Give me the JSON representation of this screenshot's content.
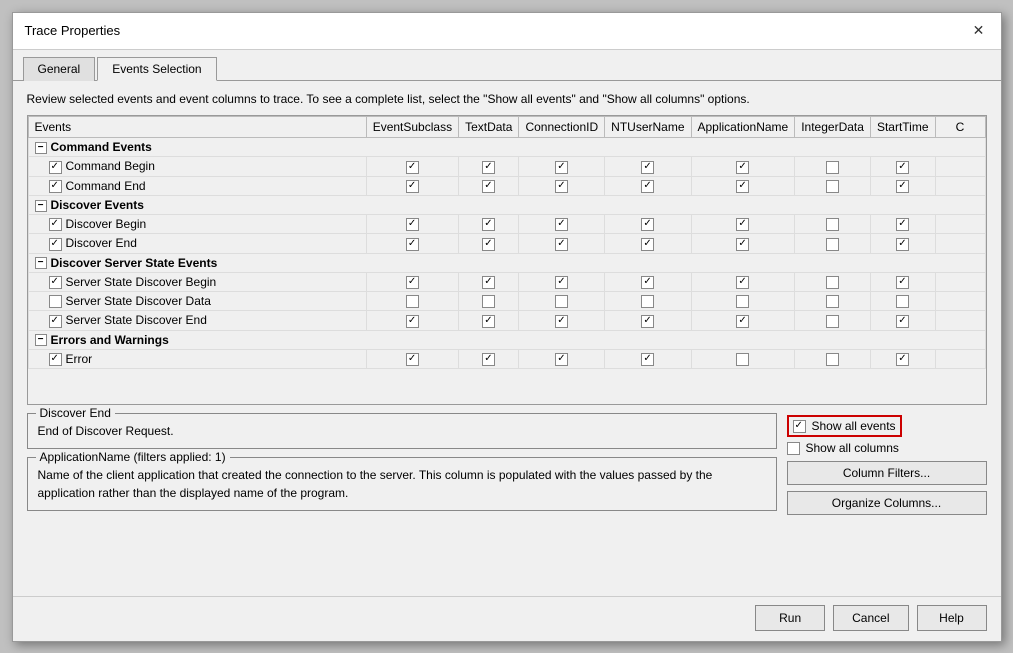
{
  "dialog": {
    "title": "Trace Properties",
    "close_label": "✕"
  },
  "tabs": [
    {
      "id": "general",
      "label": "General",
      "active": false
    },
    {
      "id": "events-selection",
      "label": "Events Selection",
      "active": true
    }
  ],
  "description": "Review selected events and event columns to trace. To see a complete list, select the \"Show all events\" and \"Show all columns\" options.",
  "table": {
    "columns": [
      "Events",
      "EventSubclass",
      "TextData",
      "ConnectionID",
      "NTUserName",
      "ApplicationName",
      "IntegerData",
      "StartTime",
      "C"
    ],
    "categories": [
      {
        "name": "Command Events",
        "rows": [
          {
            "name": "Command Begin",
            "eventsubclass": true,
            "textdata": true,
            "connectionid": true,
            "ntuserName": true,
            "applicationname": true,
            "integerdata": false,
            "starttime": true
          },
          {
            "name": "Command End",
            "eventsubclass": true,
            "textdata": true,
            "connectionid": true,
            "ntuserName": true,
            "applicationname": true,
            "integerdata": false,
            "starttime": true
          }
        ]
      },
      {
        "name": "Discover Events",
        "rows": [
          {
            "name": "Discover Begin",
            "eventsubclass": true,
            "textdata": true,
            "connectionid": true,
            "ntuserName": true,
            "applicationname": true,
            "integerdata": false,
            "starttime": true
          },
          {
            "name": "Discover End",
            "eventsubclass": true,
            "textdata": true,
            "connectionid": true,
            "ntuserName": true,
            "applicationname": true,
            "integerdata": false,
            "starttime": true
          }
        ]
      },
      {
        "name": "Discover Server State Events",
        "rows": [
          {
            "name": "Server State Discover Begin",
            "eventsubclass": true,
            "textdata": true,
            "connectionid": true,
            "ntuserName": true,
            "applicationname": true,
            "integerdata": false,
            "starttime": true
          },
          {
            "name": "Server State Discover Data",
            "eventsubclass": false,
            "textdata": false,
            "connectionid": false,
            "ntuserName": false,
            "applicationname": false,
            "integerdata": false,
            "starttime": false
          },
          {
            "name": "Server State Discover End",
            "eventsubclass": true,
            "textdata": true,
            "connectionid": true,
            "ntuserName": true,
            "applicationname": true,
            "integerdata": false,
            "starttime": true
          }
        ]
      },
      {
        "name": "Errors and Warnings",
        "rows": [
          {
            "name": "Error",
            "eventsubclass": true,
            "textdata": true,
            "connectionid": true,
            "ntuserName": true,
            "applicationname": false,
            "integerdata": false,
            "starttime": true
          }
        ]
      }
    ]
  },
  "panels": {
    "discover_end": {
      "legend": "Discover End",
      "content": "End of Discover Request."
    },
    "application_name": {
      "legend": "ApplicationName (filters applied: 1)",
      "content": "Name of the client application that created the connection to the server. This column is populated with the values passed by the application rather than the displayed name of the program."
    }
  },
  "options": {
    "show_all_events_label": "Show all events",
    "show_all_columns_label": "Show all columns",
    "show_all_events_checked": true,
    "show_all_columns_checked": false
  },
  "action_buttons": {
    "column_filters": "Column Filters...",
    "organize_columns": "Organize Columns..."
  },
  "footer_buttons": {
    "run": "Run",
    "cancel": "Cancel",
    "help": "Help"
  }
}
